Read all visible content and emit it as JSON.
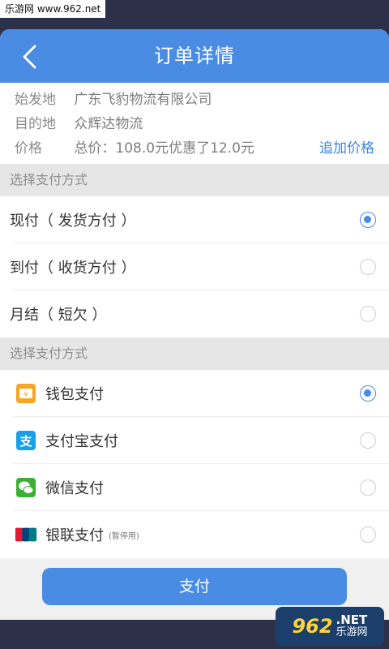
{
  "watermark_top": "乐游网 www.962.net",
  "header": {
    "title": "订单详情"
  },
  "info": {
    "origin_label": "始发地",
    "origin_value": "广东飞豹物流有限公司",
    "dest_label": "目的地",
    "dest_value": "众辉达物流",
    "price_label": "价格",
    "price_value": "总价：108.0元优惠了12.0元",
    "add_price": "追加价格"
  },
  "delivery": {
    "section_title": "选择支付方式",
    "options": [
      {
        "label": "现付（ 发货方付 ）",
        "selected": true
      },
      {
        "label": "到付（  收货方付 ）",
        "selected": false
      },
      {
        "label": "月结（ 短欠 ）",
        "selected": false
      }
    ]
  },
  "payment": {
    "section_title": "选择支付方式",
    "options": [
      {
        "label": "钱包支付",
        "icon": "wallet-icon",
        "selected": true
      },
      {
        "label": "支付宝支付",
        "icon": "alipay-icon",
        "selected": false
      },
      {
        "label": "微信支付",
        "icon": "wechat-icon",
        "selected": false
      },
      {
        "label": "银联支付",
        "note": "(暂停用)",
        "icon": "unionpay-icon",
        "selected": false
      }
    ]
  },
  "footer": {
    "pay_label": "支付"
  },
  "watermark_bottom": {
    "num": "962",
    "net": ".NET",
    "cn": "乐游网"
  },
  "colors": {
    "accent": "#4a8ce4",
    "price": "#e6317a",
    "link": "#3b86d8"
  }
}
